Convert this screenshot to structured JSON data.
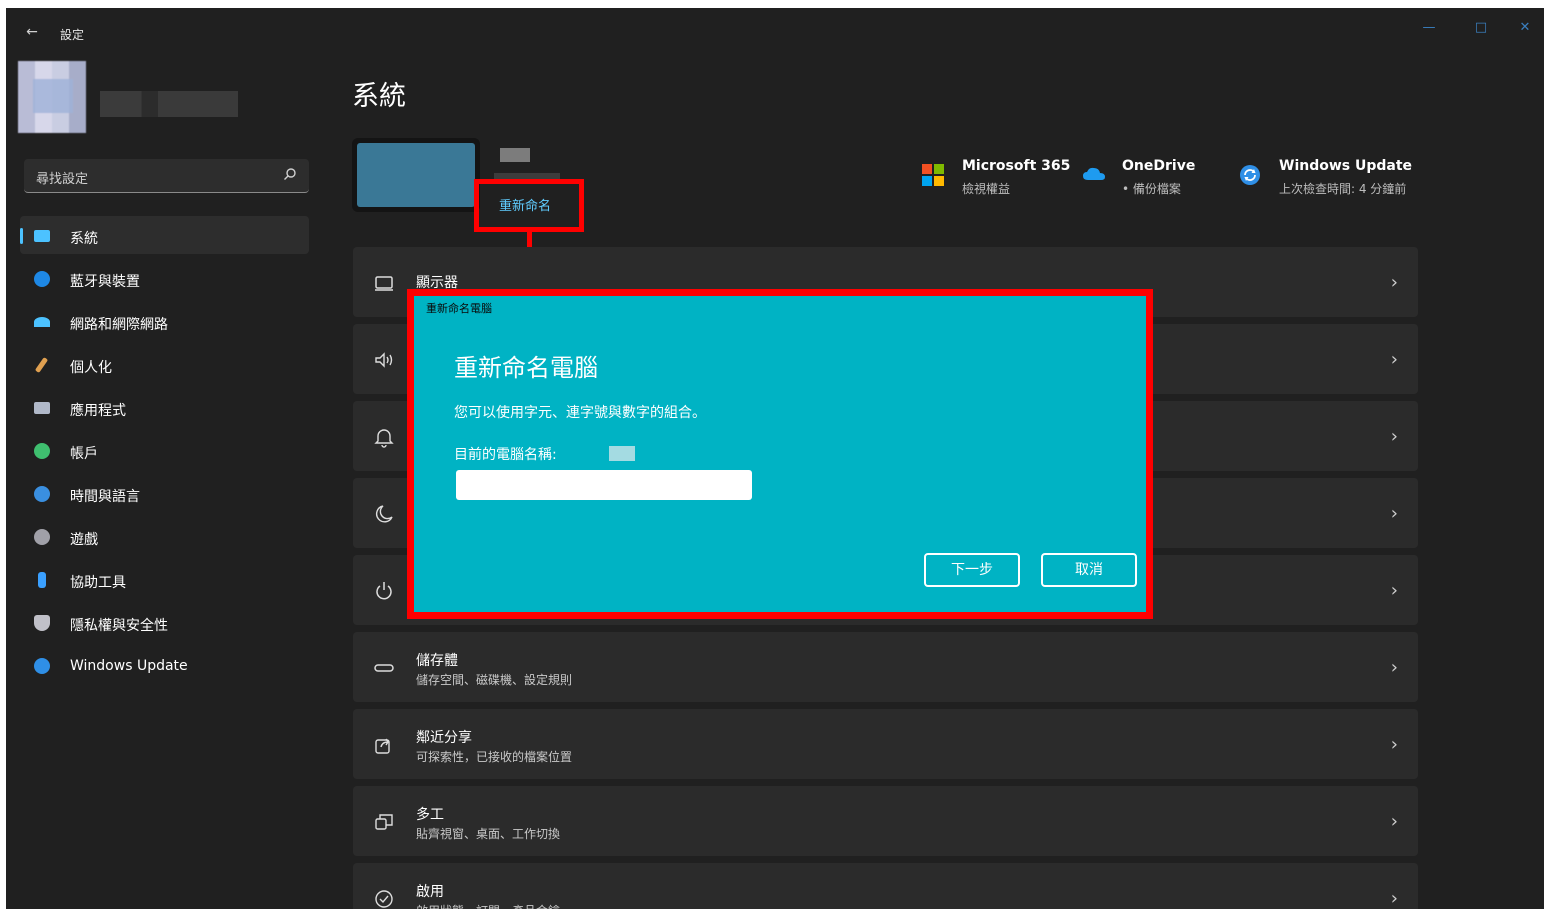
{
  "window": {
    "app_title": "設定",
    "back_glyph": "←",
    "controls": {
      "minimize": "—",
      "maximize": "□",
      "close": "✕"
    }
  },
  "sidebar": {
    "search_placeholder": "尋找設定",
    "items": [
      {
        "label": "系統",
        "icon": "monitor-icon",
        "color": "#4cc2ff",
        "active": true
      },
      {
        "label": "藍牙與裝置",
        "icon": "bluetooth-icon",
        "color": "#1e88e5"
      },
      {
        "label": "網路和網際網路",
        "icon": "wifi-icon",
        "color": "#4cc2ff"
      },
      {
        "label": "個人化",
        "icon": "brush-icon",
        "color": "#e0a050"
      },
      {
        "label": "應用程式",
        "icon": "apps-icon",
        "color": "#b0b8c8"
      },
      {
        "label": "帳戶",
        "icon": "person-icon",
        "color": "#3fbf6f"
      },
      {
        "label": "時間與語言",
        "icon": "clock-globe-icon",
        "color": "#3a8fe0"
      },
      {
        "label": "遊戲",
        "icon": "gamepad-icon",
        "color": "#a0a0a8"
      },
      {
        "label": "協助工具",
        "icon": "accessibility-icon",
        "color": "#3aa0ff"
      },
      {
        "label": "隱私權與安全性",
        "icon": "shield-icon",
        "color": "#c0c0c8"
      },
      {
        "label": "Windows Update",
        "icon": "update-icon",
        "color": "#2f8fe6"
      }
    ]
  },
  "main": {
    "page_title": "系統",
    "rename_link": "重新命名",
    "quick_links": [
      {
        "title": "Microsoft 365",
        "sub": "檢視權益",
        "icon": "microsoft-365-icon"
      },
      {
        "title": "OneDrive",
        "sub": "• 備份檔案",
        "icon": "onedrive-icon"
      },
      {
        "title": "Windows Update",
        "sub": "上次檢查時間: 4 分鐘前",
        "icon": "windows-update-icon"
      }
    ],
    "cards": [
      {
        "title": "顯示器",
        "sub": "",
        "icon": "display-icon"
      },
      {
        "title": "",
        "sub": "",
        "icon": "sound-icon"
      },
      {
        "title": "",
        "sub": "",
        "icon": "notification-icon"
      },
      {
        "title": "",
        "sub": "",
        "icon": "focus-moon-icon"
      },
      {
        "title": "",
        "sub": "",
        "icon": "power-icon"
      },
      {
        "title": "儲存體",
        "sub": "儲存空間、磁碟機、設定規則",
        "icon": "storage-icon"
      },
      {
        "title": "鄰近分享",
        "sub": "可探索性，已接收的檔案位置",
        "icon": "share-icon"
      },
      {
        "title": "多工",
        "sub": "貼齊視窗、桌面、工作切換",
        "icon": "multitask-icon"
      },
      {
        "title": "啟用",
        "sub": "啟用狀態、訂閱、產品金鑰",
        "icon": "activation-icon"
      }
    ],
    "chevron": "›"
  },
  "dialog": {
    "caption": "重新命名電腦",
    "title": "重新命名電腦",
    "description": "您可以使用字元、連字號與數字的組合。",
    "current_name_label": "目前的電腦名稱:",
    "input_value": "",
    "next_button": "下一步",
    "cancel_button": "取消"
  }
}
